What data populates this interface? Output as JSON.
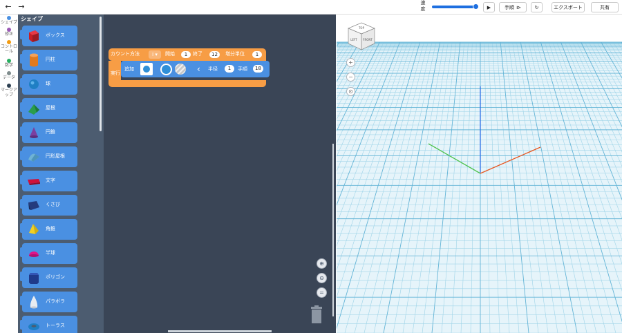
{
  "toolbar": {
    "undo_icon": "undo-icon",
    "redo_icon": "redo-icon",
    "speed_label": "速\n度",
    "speed_value": 1.0,
    "play_icon": "play-icon",
    "step_label": "手順",
    "reset_icon": "reset-icon",
    "export_label": "エクスポート",
    "share_label": "共有"
  },
  "rail": {
    "items": [
      {
        "label": "シェイプ",
        "color": "#4a90e2"
      },
      {
        "label": "修正",
        "color": "#9b59b6"
      },
      {
        "label": "コントロール",
        "color": "#f39c12"
      },
      {
        "label": "数学",
        "color": "#27ae60"
      },
      {
        "label": "データ",
        "color": "#7f8c8d"
      },
      {
        "label": "マークアップ",
        "color": "#2c3e50"
      }
    ]
  },
  "flyout": {
    "title": "シェイプ",
    "items": [
      {
        "label": "ボックス",
        "icon": "box-icon"
      },
      {
        "label": "円柱",
        "icon": "cylinder-icon"
      },
      {
        "label": "球",
        "icon": "sphere-icon"
      },
      {
        "label": "屋根",
        "icon": "roof-icon"
      },
      {
        "label": "円錐",
        "icon": "cone-icon"
      },
      {
        "label": "円形屋根",
        "icon": "round-roof-icon"
      },
      {
        "label": "文字",
        "icon": "text-icon"
      },
      {
        "label": "くさび",
        "icon": "wedge-icon"
      },
      {
        "label": "角錐",
        "icon": "pyramid-icon"
      },
      {
        "label": "半球",
        "icon": "hemisphere-icon"
      },
      {
        "label": "ポリゴン",
        "icon": "polygon-icon"
      },
      {
        "label": "パラボラ",
        "icon": "paraboloid-icon"
      },
      {
        "label": "トーラス",
        "icon": "torus-icon"
      }
    ]
  },
  "workspace": {
    "loop": {
      "count_label": "カウント方法",
      "var": "i",
      "start_label": "開始",
      "start": "1",
      "end_label": "終了",
      "end": "12",
      "step_label": "増分単位",
      "step": "1",
      "exec_label": "実行"
    },
    "add_block": {
      "label": "追加",
      "shape": "sphere-icon",
      "color": "#2f8fd8",
      "radius_label": "半径",
      "radius": "1",
      "detail_label": "手順",
      "detail": "18"
    },
    "zoom_in": "+",
    "zoom_out": "−",
    "zoom_reset": "=",
    "trash_icon": "trash-icon"
  },
  "viewport": {
    "cube_labels": {
      "top": "TOP",
      "left": "LEFT",
      "front": "FRONT"
    },
    "zoom_in": "+",
    "zoom_out": "−",
    "home": "⊙"
  }
}
